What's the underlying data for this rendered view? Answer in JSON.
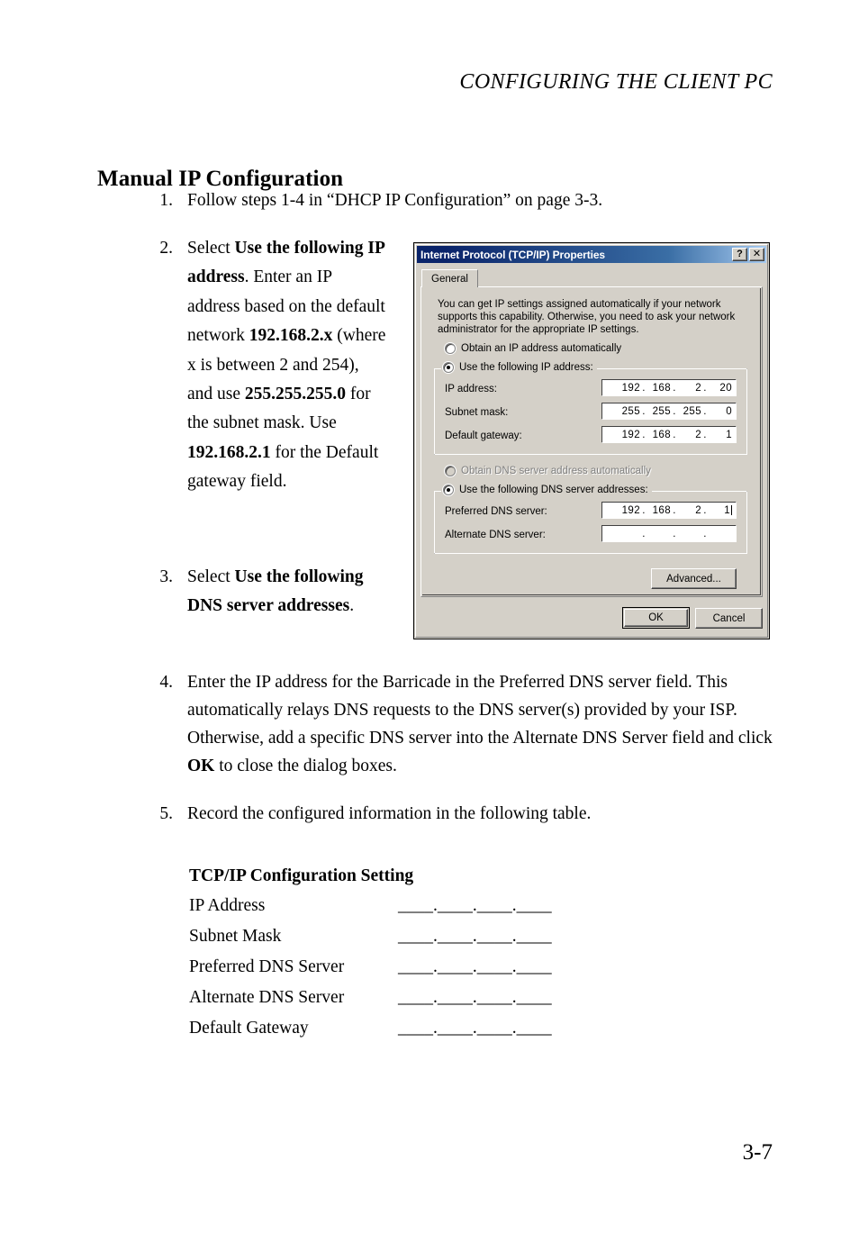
{
  "header": {
    "running_title": "CONFIGURING THE CLIENT PC"
  },
  "heading": "Manual IP Configuration",
  "folio": "3-7",
  "steps": {
    "s1_num": "1.",
    "s1_text": "Follow steps 1-4 in “DHCP IP Configuration” on page 3-3.",
    "s2_num": "2.",
    "s2_a": "Select ",
    "s2_b1": "Use the following IP address",
    "s2_c": ". Enter an IP address based on the default network ",
    "s2_b2": "192.168.2.x",
    "s2_d": " (where x is between 2 and 254), and use ",
    "s2_b3": "255.255.255.0",
    "s2_e": " for the subnet mask. Use ",
    "s2_b4": "192.168.2.1",
    "s2_f": " for the Default gateway field.",
    "s3_num": "3.",
    "s3_a": "Select ",
    "s3_b1": "Use the following DNS server addresses",
    "s3_c": ".",
    "s4_num": "4.",
    "s4_a": "Enter the IP address for the Barricade in the Preferred DNS server field. This automatically relays DNS requests to the DNS server(s) provided by your ISP. Otherwise, add a specific DNS server into the Alternate DNS Server field and click ",
    "s4_b1": "OK",
    "s4_c": " to close the dialog boxes.",
    "s5_num": "5.",
    "s5_text": "Record the configured information in the following table."
  },
  "record_table": {
    "title": "TCP/IP Configuration Setting",
    "blank": "____.____.____.____",
    "rows": [
      {
        "label": "IP Address"
      },
      {
        "label": "Subnet Mask"
      },
      {
        "label": "Preferred DNS Server"
      },
      {
        "label": "Alternate DNS Server"
      },
      {
        "label": "Default Gateway"
      }
    ]
  },
  "dialog": {
    "title": "Internet Protocol (TCP/IP) Properties",
    "help_button": "?",
    "close_button": "✕",
    "tab_general": "General",
    "intro": "You can get IP settings assigned automatically if your network supports this capability. Otherwise, you need to ask your network administrator for the appropriate IP settings.",
    "radio_obtain_ip": "Obtain an IP address automatically",
    "radio_use_ip": "Use the following IP address:",
    "label_ip_address": "IP address:",
    "label_subnet_mask": "Subnet mask:",
    "label_default_gateway": "Default gateway:",
    "radio_obtain_dns": "Obtain DNS server address automatically",
    "radio_use_dns": "Use the following DNS server addresses:",
    "label_preferred_dns": "Preferred DNS server:",
    "label_alternate_dns": "Alternate DNS server:",
    "value_ip_address": [
      "192",
      "168",
      "2",
      "20"
    ],
    "value_subnet_mask": [
      "255",
      "255",
      "255",
      "0"
    ],
    "value_default_gateway": [
      "192",
      "168",
      "2",
      "1"
    ],
    "value_preferred_dns": [
      "192",
      "168",
      "2",
      "1"
    ],
    "value_alternate_dns": [
      "",
      "",
      "",
      ""
    ],
    "btn_advanced": "Advanced...",
    "btn_ok": "OK",
    "btn_cancel": "Cancel",
    "colors": {
      "face": "#d4d0c8",
      "titlebar_start": "#0a246a",
      "titlebar_end": "#a6caf0",
      "disabled_text": "#808080"
    }
  }
}
